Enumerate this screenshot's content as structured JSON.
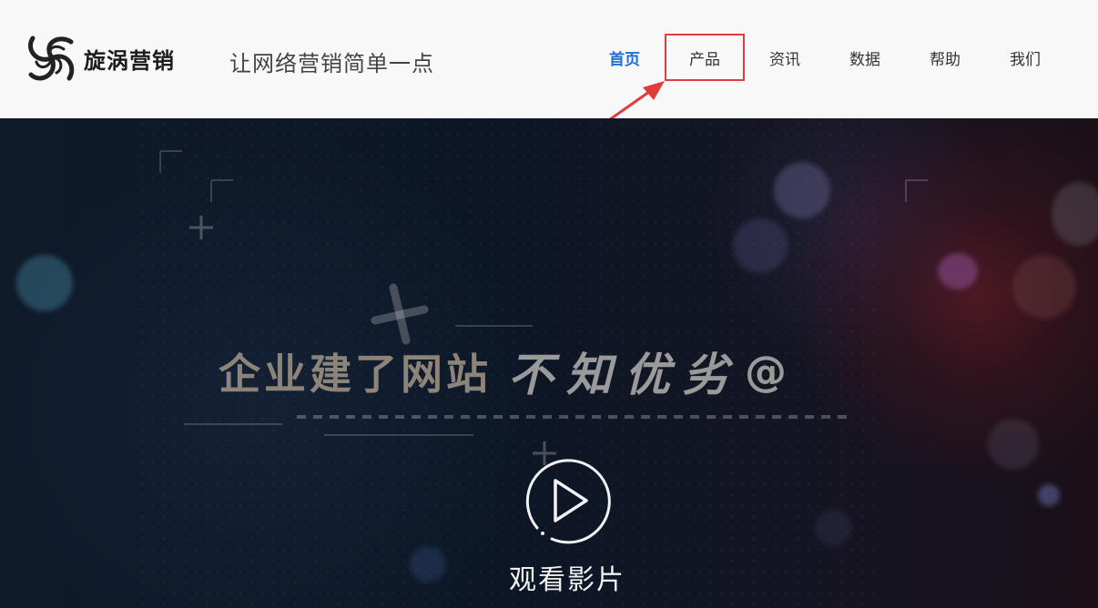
{
  "brand": {
    "logo_text": "旋涡营销",
    "slogan": "让网络营销简单一点",
    "logo_icon": "swirl-logo-icon"
  },
  "nav": {
    "items": [
      {
        "label": "首页",
        "active": true
      },
      {
        "label": "产品",
        "highlighted": true
      },
      {
        "label": "资讯"
      },
      {
        "label": "数据"
      },
      {
        "label": "帮助"
      },
      {
        "label": "我们"
      }
    ]
  },
  "hero": {
    "title_part1": "企业建了网站",
    "title_part2": "不知优劣",
    "title_part3": "@",
    "watch_label": "观看影片",
    "play_icon": "play-icon"
  },
  "colors": {
    "nav_active": "#1f6fd6",
    "highlight_border": "#e23b3b",
    "header_bg": "#f8f8f8",
    "hero_bg": "#0c1626"
  }
}
